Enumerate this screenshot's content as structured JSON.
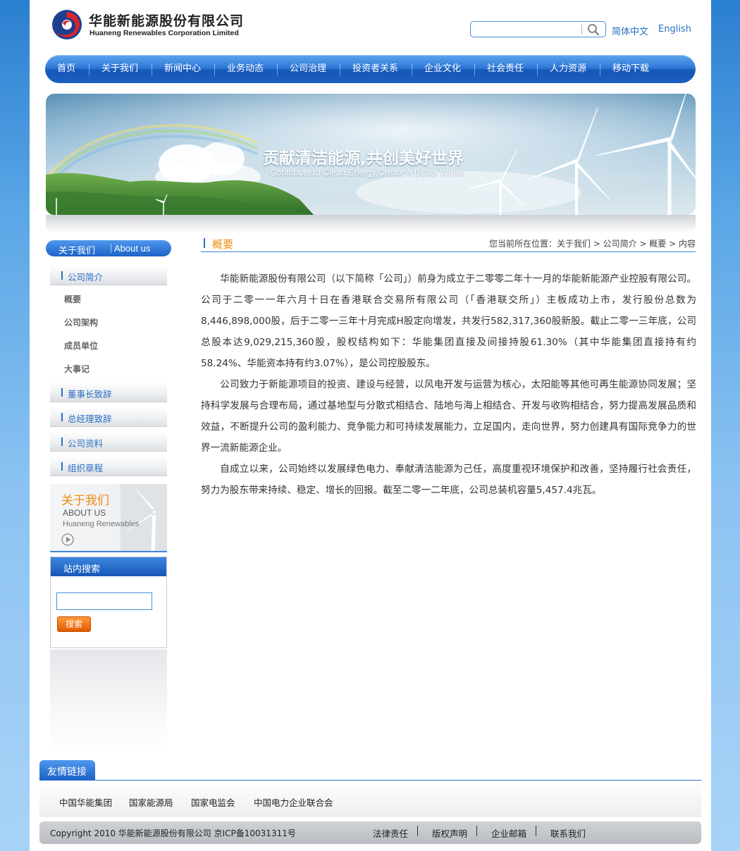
{
  "header": {
    "company_cn": "华能新能源股份有限公司",
    "company_en": "Huaneng Renewables Corporation Limited",
    "lang_cn": "简体中文",
    "lang_en": "English"
  },
  "nav": [
    "首页",
    "关于我们",
    "新闻中心",
    "业务动态",
    "公司治理",
    "投资者关系",
    "企业文化",
    "社会责任",
    "人力资源",
    "移动下载"
  ],
  "banner": {
    "title": "贡献清洁能源,共创美好世界",
    "subtitle": "Contribute to Clean Energy,Create a Better World"
  },
  "sidebar": {
    "head_cn": "关于我们",
    "head_en": "About us",
    "tabs": [
      "公司简介",
      "董事长致辞",
      "总经理致辞",
      "公司资料",
      "组织章程"
    ],
    "subitems": [
      "概要",
      "公司架构",
      "成员单位",
      "大事记"
    ],
    "about_cn": "关于我们",
    "about_en": "ABOUT US",
    "about_en2": "Huaneng Renewables",
    "search_title": "站内搜索",
    "search_btn": "搜索"
  },
  "main": {
    "title": "概要",
    "breadcrumb": "您当前所在位置：关于我们 > 公司简介 > 概要 > 内容",
    "paragraphs": [
      "华能新能源股份有限公司（以下简称「公司」）前身为成立于二零零二年十一月的华能新能源产业控股有限公司。公司于二零一一年六月十日在香港联合交易所有限公司（「香港联交所」）主板成功上市，发行股份总数为8,446,898,000股，后于二零一三年十月完成H股定向增发，共发行582,317,360股新股。截止二零一三年底，公司总股本达9,029,215,360股，股权结构如下：华能集团直接及间接持股61.30%（其中华能集团直接持有约58.24%、华能资本持有约3.07%），是公司控股股东。",
      "公司致力于新能源项目的投资、建设与经营，以风电开发与运营为核心，太阳能等其他可再生能源协同发展；坚持科学发展与合理布局，通过基地型与分散式相结合、陆地与海上相结合、开发与收购相结合，努力提高发展品质和效益，不断提升公司的盈利能力、竞争能力和可持续发展能力，立足国内，走向世界，努力创建具有国际竞争力的世界一流新能源企业。",
      "自成立以来，公司始终以发展绿色电力、奉献清洁能源为己任，高度重视环境保护和改善，坚持履行社会责任，努力为股东带来持续、稳定、增长的回报。截至二零一二年底，公司总装机容量5,457.4兆瓦。"
    ]
  },
  "footer": {
    "links_title": "友情链接",
    "links": [
      "中国华能集团",
      "国家能源局",
      "国家电监会",
      "中国电力企业联合会"
    ],
    "copyright": "Copyright 2010 华能新能源股份有限公司 京ICP备10031311号",
    "bottom_links": [
      "法律责任",
      "版权声明",
      "企业邮箱",
      "联系我们"
    ]
  },
  "colors": {
    "nav_blue": "#1b5fc0",
    "accent_orange": "#f08a10",
    "link_blue": "#2a6fc4"
  }
}
